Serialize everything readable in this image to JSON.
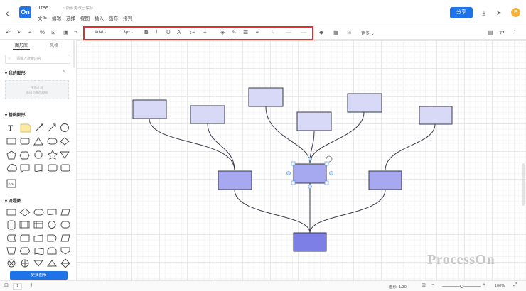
{
  "header": {
    "back_icon": "chevron-left-icon",
    "logo": "On",
    "title": "Tree",
    "save_status": "所有更改已保存",
    "menu": [
      "文件",
      "编辑",
      "选择",
      "视图",
      "插入",
      "画布",
      "排列"
    ],
    "share_label": "分享",
    "avatar_letter": "P"
  },
  "toolbar": {
    "font_family": "Arial",
    "font_size": "13px",
    "bold": "B",
    "italic": "I",
    "underline": "U",
    "font_color": "A",
    "more_label": "更多",
    "highlight_color": "#e0302d"
  },
  "sidebar": {
    "tabs": [
      "图形库",
      "风格"
    ],
    "search_placeholder": "请输入搜索内容",
    "my_shapes_title": "我的图形",
    "my_shapes_hint_1": "拖到此处",
    "my_shapes_hint_2": "添加到我的图形",
    "basic_title": "基础图形",
    "flow_title": "流程图",
    "more_shapes_label": "更多图形"
  },
  "canvas": {
    "watermark": "ProcessOn",
    "node_colors": {
      "light": "#d8d9f7",
      "mid": "#a7a9f0",
      "dark": "#7d7fe6",
      "stroke": "#3a3a4a"
    }
  },
  "status": {
    "page_number": "1",
    "shape_info": "图形: 1/30",
    "zoom": "100%"
  }
}
